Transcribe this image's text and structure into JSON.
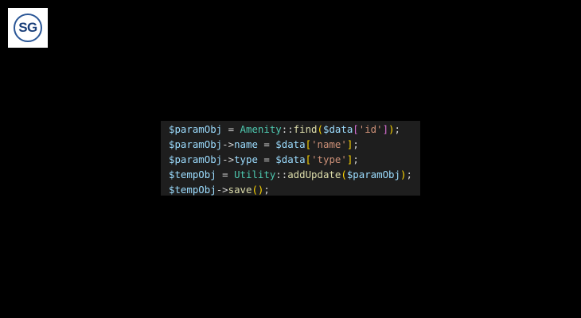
{
  "logo": {
    "text": "SG",
    "color": "#1a3f7a"
  },
  "code": {
    "background": "#1e1e1e",
    "lines": [
      [
        {
          "t": "$paramObj",
          "c": "var"
        },
        {
          "t": " = ",
          "c": "op"
        },
        {
          "t": "Amenity",
          "c": "cls"
        },
        {
          "t": "::",
          "c": "op"
        },
        {
          "t": "find",
          "c": "fn"
        },
        {
          "t": "(",
          "c": "brk"
        },
        {
          "t": "$data",
          "c": "var"
        },
        {
          "t": "[",
          "c": "brk2"
        },
        {
          "t": "'id'",
          "c": "str"
        },
        {
          "t": "]",
          "c": "brk2"
        },
        {
          "t": ")",
          "c": "brk"
        },
        {
          "t": ";",
          "c": "plain"
        }
      ],
      [
        {
          "t": "$paramObj",
          "c": "var"
        },
        {
          "t": "->",
          "c": "op"
        },
        {
          "t": "name",
          "c": "var"
        },
        {
          "t": " = ",
          "c": "op"
        },
        {
          "t": "$data",
          "c": "var"
        },
        {
          "t": "[",
          "c": "brk"
        },
        {
          "t": "'name'",
          "c": "str"
        },
        {
          "t": "]",
          "c": "brk"
        },
        {
          "t": ";",
          "c": "plain"
        }
      ],
      [
        {
          "t": "$paramObj",
          "c": "var"
        },
        {
          "t": "->",
          "c": "op"
        },
        {
          "t": "type",
          "c": "var"
        },
        {
          "t": " = ",
          "c": "op"
        },
        {
          "t": "$data",
          "c": "var"
        },
        {
          "t": "[",
          "c": "brk"
        },
        {
          "t": "'type'",
          "c": "str"
        },
        {
          "t": "]",
          "c": "brk"
        },
        {
          "t": ";",
          "c": "plain"
        }
      ],
      [
        {
          "t": "$tempObj",
          "c": "var"
        },
        {
          "t": " = ",
          "c": "op"
        },
        {
          "t": "Utility",
          "c": "cls"
        },
        {
          "t": "::",
          "c": "op"
        },
        {
          "t": "addUpdate",
          "c": "fn"
        },
        {
          "t": "(",
          "c": "brk"
        },
        {
          "t": "$paramObj",
          "c": "var"
        },
        {
          "t": ")",
          "c": "brk"
        },
        {
          "t": ";",
          "c": "plain"
        }
      ],
      [
        {
          "t": "$tempObj",
          "c": "var"
        },
        {
          "t": "->",
          "c": "op"
        },
        {
          "t": "save",
          "c": "fn"
        },
        {
          "t": "()",
          "c": "brk"
        },
        {
          "t": ";",
          "c": "plain"
        }
      ]
    ]
  }
}
